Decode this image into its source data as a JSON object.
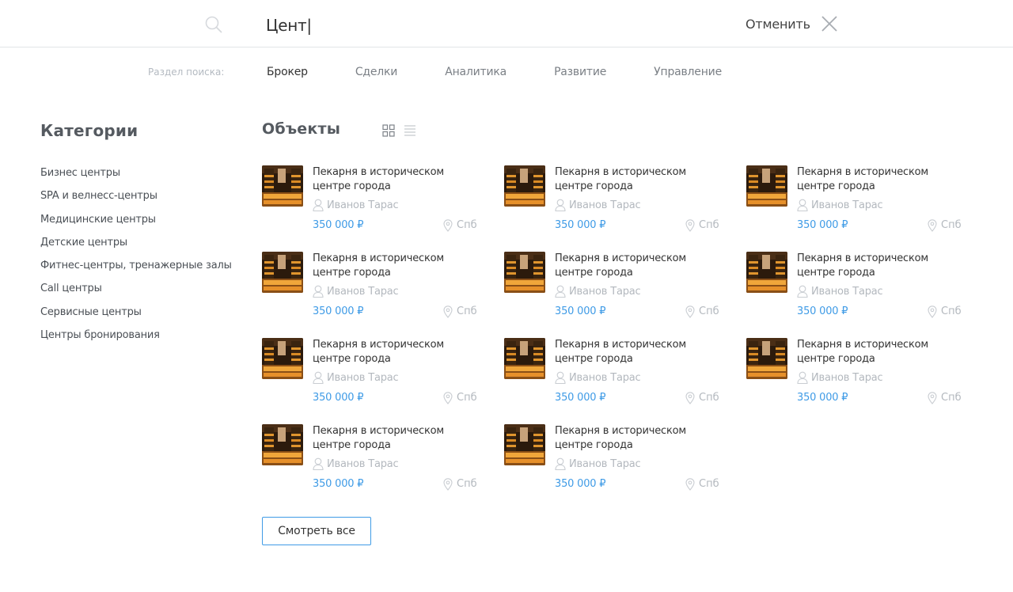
{
  "search": {
    "query": "Цент|",
    "cancel_label": "Отменить"
  },
  "sections": {
    "label": "Раздел поиска:",
    "tabs": [
      {
        "label": "Брокер",
        "active": true
      },
      {
        "label": "Сделки",
        "active": false
      },
      {
        "label": "Аналитика",
        "active": false
      },
      {
        "label": "Развитие",
        "active": false
      },
      {
        "label": "Управление",
        "active": false
      }
    ]
  },
  "categories": {
    "title": "Категории",
    "items": [
      "Бизнес центры",
      "SPA и велнесс-центры",
      "Медицинские центры",
      "Детские центры",
      "Фитнес-центры, тренажерные залы",
      "Call центры",
      "Сервисные центры",
      "Центры бронирования"
    ]
  },
  "objects": {
    "title": "Объекты",
    "view_icons": [
      "grid-icon",
      "list-icon"
    ],
    "items": [
      {
        "title": "Пекарня в историческом центре города",
        "author": "Иванов Тарас",
        "price": "350 000 ₽",
        "city": "Спб"
      },
      {
        "title": "Пекарня в историческом центре города",
        "author": "Иванов Тарас",
        "price": "350 000 ₽",
        "city": "Спб"
      },
      {
        "title": "Пекарня в историческом центре города",
        "author": "Иванов Тарас",
        "price": "350 000 ₽",
        "city": "Спб"
      },
      {
        "title": "Пекарня в историческом центре города",
        "author": "Иванов Тарас",
        "price": "350 000 ₽",
        "city": "Спб"
      },
      {
        "title": "Пекарня в историческом центре города",
        "author": "Иванов Тарас",
        "price": "350 000 ₽",
        "city": "Спб"
      },
      {
        "title": "Пекарня в историческом центре города",
        "author": "Иванов Тарас",
        "price": "350 000 ₽",
        "city": "Спб"
      },
      {
        "title": "Пекарня в историческом центре города",
        "author": "Иванов Тарас",
        "price": "350 000 ₽",
        "city": "Спб"
      },
      {
        "title": "Пекарня в историческом центре города",
        "author": "Иванов Тарас",
        "price": "350 000 ₽",
        "city": "Спб"
      },
      {
        "title": "Пекарня в историческом центре города",
        "author": "Иванов Тарас",
        "price": "350 000 ₽",
        "city": "Спб"
      },
      {
        "title": "Пекарня в историческом центре города",
        "author": "Иванов Тарас",
        "price": "350 000 ₽",
        "city": "Спб"
      },
      {
        "title": "Пекарня в историческом центре города",
        "author": "Иванов Тарас",
        "price": "350 000 ₽",
        "city": "Спб"
      }
    ],
    "view_all_label": "Смотреть все"
  },
  "colors": {
    "accent": "#3f9be6",
    "muted": "#b3b8be",
    "text": "#333333"
  }
}
